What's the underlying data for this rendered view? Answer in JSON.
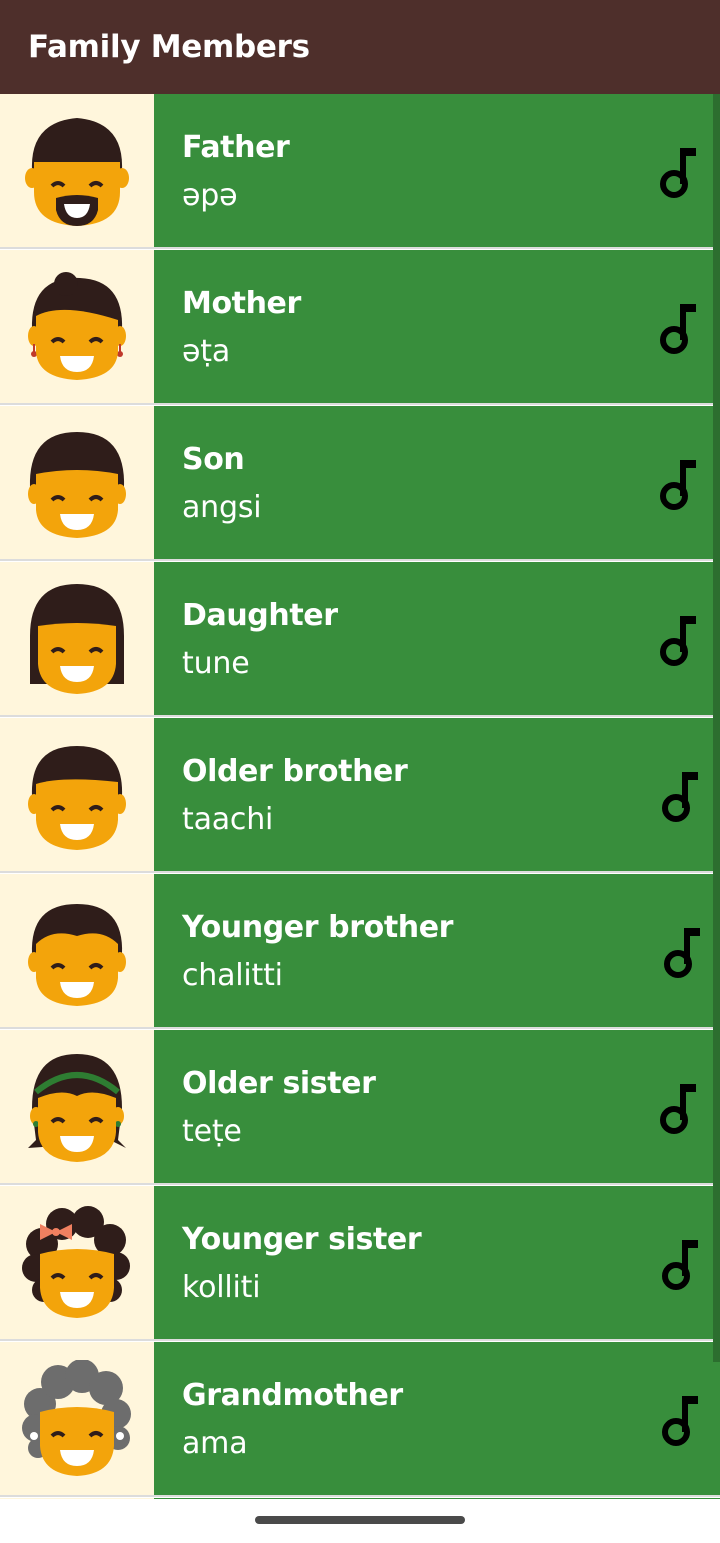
{
  "appbar": {
    "title": "Family Members"
  },
  "colors": {
    "appbar": "#4e2f2b",
    "row_green": "#388e3c",
    "thumb_bg": "#fff6dc",
    "skin": "#f3a40b",
    "hair": "#2f1d1a"
  },
  "play_icon": "music-note-icon",
  "items": [
    {
      "english": "Father",
      "miwok": "əpə",
      "avatar": "man-with-goatee"
    },
    {
      "english": "Mother",
      "miwok": "əṭa",
      "avatar": "woman-with-earrings"
    },
    {
      "english": "Son",
      "miwok": "angsi",
      "avatar": "boy"
    },
    {
      "english": "Daughter",
      "miwok": "tune",
      "avatar": "girl"
    },
    {
      "english": "Older brother",
      "miwok": "taachi",
      "avatar": "older-boy"
    },
    {
      "english": "Younger brother",
      "miwok": "chalitti",
      "avatar": "younger-boy"
    },
    {
      "english": "Older sister",
      "miwok": "teṭe",
      "avatar": "girl-with-headband"
    },
    {
      "english": "Younger sister",
      "miwok": "kolliti",
      "avatar": "girl-with-bow"
    },
    {
      "english": "Grandmother",
      "miwok": "ama",
      "avatar": "grandmother"
    }
  ]
}
